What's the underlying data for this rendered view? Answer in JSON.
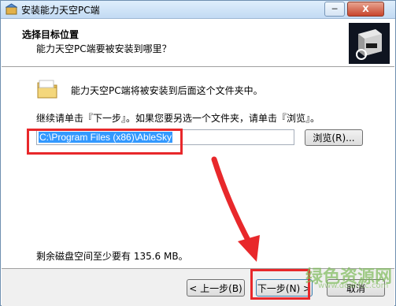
{
  "window": {
    "title": "安装能力天空PC端",
    "minimize": "─",
    "close": "X"
  },
  "header": {
    "title": "选择目标位置",
    "subtitle": "能力天空PC端要被安装到哪里？",
    "logo_icon": "installer-box-icon"
  },
  "body": {
    "install_text": "能力天空PC端将被安装到后面这个文件夹中。",
    "hint_text": "继续请单击『下一步』。如果您要另选一个文件夹，请单击『浏览』。",
    "path_value": "C:\\Program Files (x86)\\AbleSky",
    "browse_label": "浏览(R)...",
    "space_text": "剩余磁盘空间至少要有 135.6 MB。"
  },
  "footer": {
    "back_label": "< 上一步(B)",
    "next_label": "下一步(N) >",
    "cancel_label": "取消"
  },
  "watermark": {
    "text": "绿色资源网",
    "url": "www.downcc.com"
  },
  "colors": {
    "annotation_red": "#e8282b",
    "selection_blue": "#3399ff"
  }
}
